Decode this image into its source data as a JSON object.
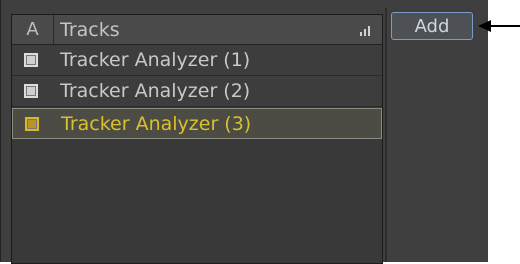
{
  "tracks_list": {
    "column_a_label": "A",
    "column_tracks_label": "Tracks",
    "rows": [
      {
        "label": "Tracker Analyzer (1)",
        "selected": false
      },
      {
        "label": "Tracker Analyzer (2)",
        "selected": false
      },
      {
        "label": "Tracker Analyzer (3)",
        "selected": true
      }
    ]
  },
  "add_button": {
    "label": "Add"
  },
  "colors": {
    "panel_bg": "#3f3f3f",
    "selected_text": "#d9c12e",
    "button_border": "#7a9cc6"
  }
}
